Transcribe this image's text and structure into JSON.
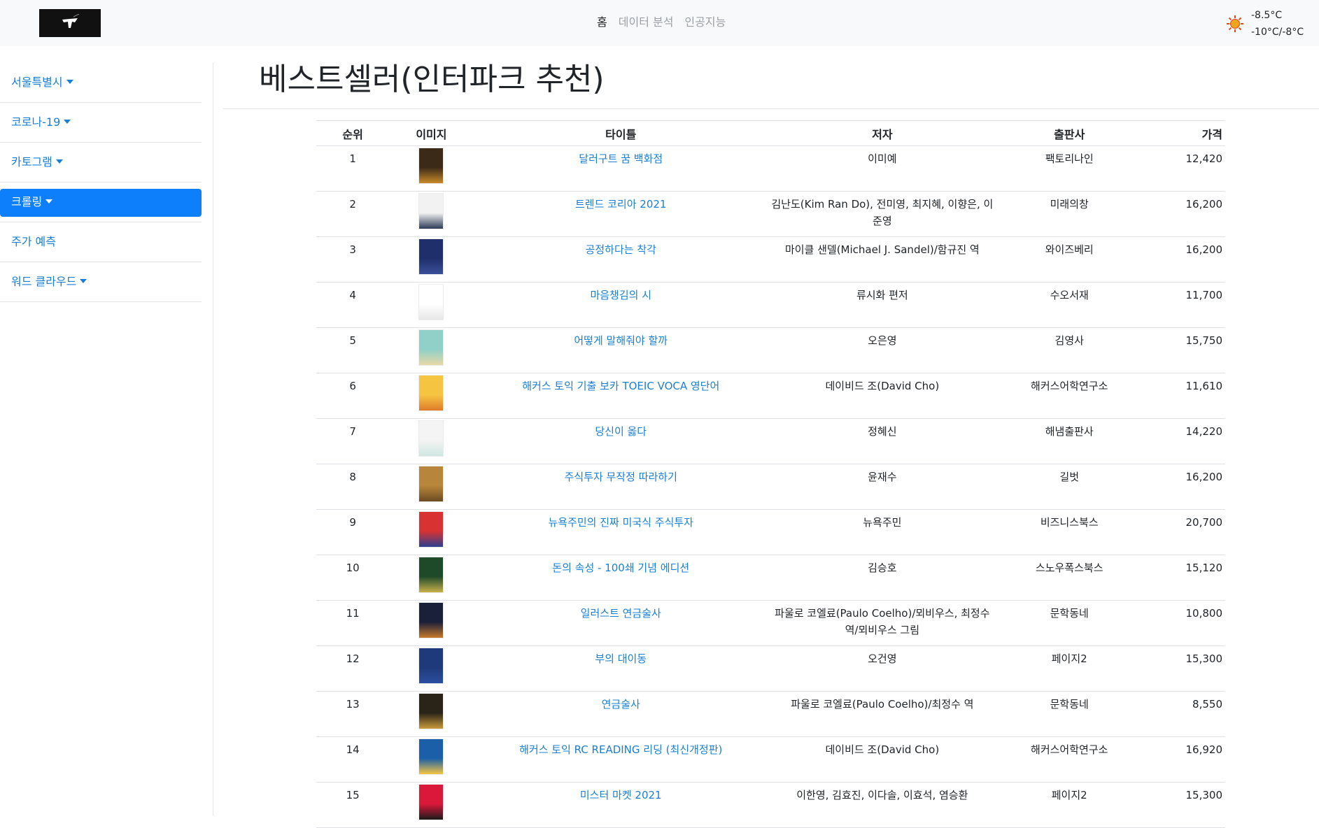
{
  "navbar": {
    "links": [
      {
        "label": "홈",
        "active": true
      },
      {
        "label": "데이터 분석",
        "active": false
      },
      {
        "label": "인공지능",
        "active": false
      }
    ],
    "weather": {
      "icon": "sun-icon",
      "current": "-8.5°C",
      "range": "-10°C/-8°C"
    }
  },
  "sidebar": {
    "items": [
      {
        "label": "서울특별시",
        "dropdown": true,
        "active": false
      },
      {
        "label": "코로나-19",
        "dropdown": true,
        "active": false
      },
      {
        "label": "카토그램",
        "dropdown": true,
        "active": false
      },
      {
        "label": "크롤링",
        "dropdown": true,
        "active": true
      },
      {
        "label": "주가 예측",
        "dropdown": false,
        "active": false
      },
      {
        "label": "워드 클라우드",
        "dropdown": true,
        "active": false
      }
    ]
  },
  "main": {
    "title": "베스트셀러(인터파크 추천)",
    "table": {
      "headers": [
        "순위",
        "이미지",
        "타이틀",
        "저자",
        "출판사",
        "가격"
      ],
      "rows": [
        {
          "rank": "1",
          "title": "달러구트 꿈 백화점",
          "author": "이미예",
          "publisher": "팩토리나인",
          "price": "12,420",
          "cover": [
            "#3b2a18",
            "#c98a2a"
          ]
        },
        {
          "rank": "2",
          "title": "트렌드 코리아 2021",
          "author": "김난도(Kim Ran Do), 전미영, 최지혜, 이향은, 이준영",
          "publisher": "미래의창",
          "price": "16,200",
          "cover": [
            "#f2f2f2",
            "#2b3a55"
          ]
        },
        {
          "rank": "3",
          "title": "공정하다는 착각",
          "author": "마이클 샌델(Michael J. Sandel)/함규진 역",
          "publisher": "와이즈베리",
          "price": "16,200",
          "cover": [
            "#1f2f6b",
            "#3b4f9a"
          ]
        },
        {
          "rank": "4",
          "title": "마음챙김의 시",
          "author": "류시화 편저",
          "publisher": "수오서재",
          "price": "11,700",
          "cover": [
            "#ffffff",
            "#e8e8e8"
          ]
        },
        {
          "rank": "5",
          "title": "어떻게 말해줘야 할까",
          "author": "오은영",
          "publisher": "김영사",
          "price": "15,750",
          "cover": [
            "#8fd0c8",
            "#e8d9a8"
          ]
        },
        {
          "rank": "6",
          "title": "해커스 토익 기출 보카 TOEIC VOCA 영단어",
          "author": "데이비드 조(David Cho)",
          "publisher": "해커스어학연구소",
          "price": "11,610",
          "cover": [
            "#f5c542",
            "#e07b2a"
          ]
        },
        {
          "rank": "7",
          "title": "당신이 옳다",
          "author": "정혜신",
          "publisher": "해냄출판사",
          "price": "14,220",
          "cover": [
            "#f4f4f4",
            "#cfe6e0"
          ]
        },
        {
          "rank": "8",
          "title": "주식투자 무작정 따라하기",
          "author": "윤재수",
          "publisher": "길벗",
          "price": "16,200",
          "cover": [
            "#b8863a",
            "#6b4a22"
          ]
        },
        {
          "rank": "9",
          "title": "뉴욕주민의 진짜 미국식 주식투자",
          "author": "뉴욕주민",
          "publisher": "비즈니스북스",
          "price": "20,700",
          "cover": [
            "#d93232",
            "#2a3f8f"
          ]
        },
        {
          "rank": "10",
          "title": "돈의 속성 - 100쇄 기념 에디션",
          "author": "김승호",
          "publisher": "스노우폭스북스",
          "price": "15,120",
          "cover": [
            "#1f4a2a",
            "#c9b04a"
          ]
        },
        {
          "rank": "11",
          "title": "일러스트 연금술사",
          "author": "파울로 코엘료(Paulo Coelho)/뫼비우스, 최정수 역/뫼비우스 그림",
          "publisher": "문학동네",
          "price": "10,800",
          "cover": [
            "#1a1f3a",
            "#c8792a"
          ]
        },
        {
          "rank": "12",
          "title": "부의 대이동",
          "author": "오건영",
          "publisher": "페이지2",
          "price": "15,300",
          "cover": [
            "#1f3a7a",
            "#2a4fa0"
          ]
        },
        {
          "rank": "13",
          "title": "연금술사",
          "author": "파울로 코엘료(Paulo Coelho)/최정수 역",
          "publisher": "문학동네",
          "price": "8,550",
          "cover": [
            "#2a2418",
            "#c99a3a"
          ]
        },
        {
          "rank": "14",
          "title": "해커스 토익 RC READING 리딩 (최신개정판)",
          "author": "데이비드 조(David Cho)",
          "publisher": "해커스어학연구소",
          "price": "16,920",
          "cover": [
            "#1a5fa8",
            "#f5c542"
          ]
        },
        {
          "rank": "15",
          "title": "미스터 마켓 2021",
          "author": "이한영, 김효진, 이다솔, 이효석, 염승환",
          "publisher": "페이지2",
          "price": "15,300",
          "cover": [
            "#d9183a",
            "#1a1a1a"
          ]
        }
      ]
    }
  },
  "colors": {
    "link": "#1a7fd4",
    "active_bg": "#0d7ffb",
    "navbar_bg": "#f8f9fa"
  }
}
